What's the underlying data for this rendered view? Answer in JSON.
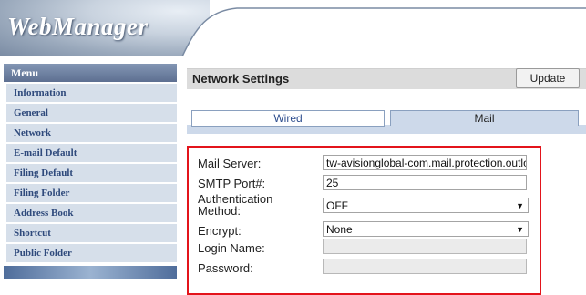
{
  "app": {
    "logo_text": "WebManager"
  },
  "sidebar": {
    "heading": "Menu",
    "items": [
      {
        "label": "Information"
      },
      {
        "label": "General"
      },
      {
        "label": "Network"
      },
      {
        "label": "E-mail Default"
      },
      {
        "label": "Filing Default"
      },
      {
        "label": "Filing Folder"
      },
      {
        "label": "Address Book"
      },
      {
        "label": "Shortcut"
      },
      {
        "label": "Public Folder"
      }
    ]
  },
  "panel": {
    "title": "Network Settings",
    "update_label": "Update"
  },
  "tabs": [
    {
      "label": "Wired"
    },
    {
      "label": "Mail",
      "active": true
    }
  ],
  "form": {
    "mail_server_label": "Mail Server:",
    "mail_server_value": "tw-avisionglobal-com.mail.protection.outlook.com",
    "smtp_port_label": "SMTP Port#:",
    "smtp_port_value": "25",
    "auth_label": "Authentication Method:",
    "auth_value": "OFF",
    "encrypt_label": "Encrypt:",
    "encrypt_value": "None",
    "login_label": "Login Name:",
    "login_value": "",
    "password_label": "Password:",
    "password_value": ""
  },
  "colors": {
    "highlight": "#e3141b",
    "menu_text": "#2f4a7c",
    "tab_active": "#cdd9ea"
  }
}
